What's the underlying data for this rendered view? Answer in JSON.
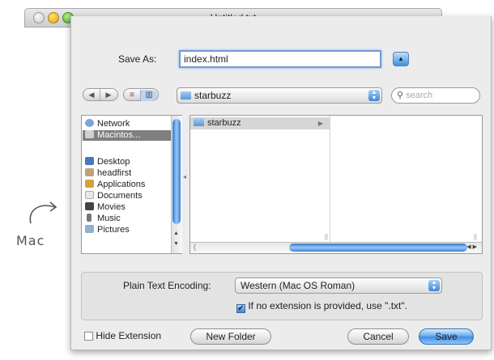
{
  "annotation": {
    "label": "Mac"
  },
  "window": {
    "title": "Untitled.txt"
  },
  "save_as": {
    "label": "Save As:",
    "value": "index.html"
  },
  "toolbar": {
    "location": "starbuzz",
    "search_placeholder": "search"
  },
  "sidebar": {
    "items": [
      {
        "label": "Network",
        "icon": "globe-icon"
      },
      {
        "label": "Macintos...",
        "icon": "disk-icon",
        "selected": true
      },
      {
        "label": "Desktop",
        "icon": "desktop-icon"
      },
      {
        "label": "headfirst",
        "icon": "home-icon"
      },
      {
        "label": "Applications",
        "icon": "applications-icon"
      },
      {
        "label": "Documents",
        "icon": "document-icon"
      },
      {
        "label": "Movies",
        "icon": "movies-icon"
      },
      {
        "label": "Music",
        "icon": "music-icon"
      },
      {
        "label": "Pictures",
        "icon": "pictures-icon"
      }
    ]
  },
  "browser": {
    "columns": [
      {
        "items": [
          "starbuzz"
        ]
      }
    ]
  },
  "options": {
    "encoding_label": "Plain Text Encoding:",
    "encoding_value": "Western (Mac OS Roman)",
    "extension_checkbox_label": "If no extension is provided, use \".txt\".",
    "extension_checked": true
  },
  "footer": {
    "hide_extension_label": "Hide Extension",
    "hide_extension_checked": false,
    "new_folder_label": "New Folder",
    "cancel_label": "Cancel",
    "save_label": "Save"
  },
  "colors": {
    "accent": "#3f8ce3",
    "selection": "#d6d6d6"
  }
}
